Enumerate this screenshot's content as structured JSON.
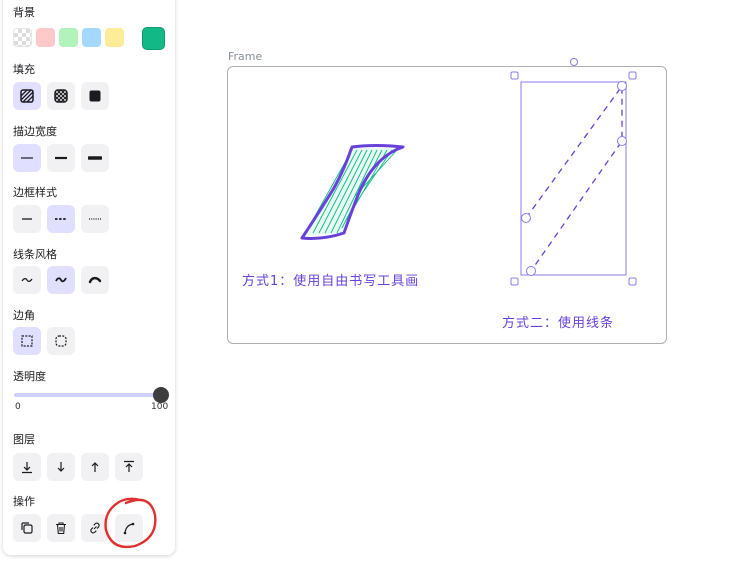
{
  "panel": {
    "background_label": "背景",
    "background_colors": [
      "transparent",
      "#ffc9c9",
      "#b2f2bb",
      "#a5d8ff",
      "#ffec99"
    ],
    "stroke_color": "#12b886",
    "fill_label": "填充",
    "fill_options": [
      "hachure-icon",
      "cross-hatch-icon",
      "solid-icon"
    ],
    "stroke_width_label": "描边宽度",
    "stroke_width_options": [
      "thin",
      "bold",
      "extra-bold"
    ],
    "stroke_style_label": "边框样式",
    "stroke_style_options": [
      "solid",
      "dashed",
      "dotted"
    ],
    "sloppiness_label": "线条风格",
    "sloppiness_options": [
      "architect",
      "artist",
      "cartoonist"
    ],
    "edges_label": "边角",
    "edges_options": [
      "sharp",
      "round"
    ],
    "opacity_label": "透明度",
    "opacity_min": "0",
    "opacity_max": "100",
    "opacity_value": 100,
    "layers_label": "图层",
    "layers_options": [
      "send-to-back-icon",
      "send-backward-icon",
      "bring-forward-icon",
      "bring-to-front-icon"
    ],
    "actions_label": "操作",
    "actions_options": [
      "duplicate-icon",
      "delete-icon",
      "link-icon",
      "curve-edit-icon"
    ]
  },
  "canvas": {
    "frame_label": "Frame",
    "caption_1": "方式1：使用自由书写工具画",
    "caption_2": "方式二：使用线条",
    "accent_color": "#6741d9",
    "selection_color": "#8b7be8",
    "hachure_color": "#12b886",
    "annotation_color": "#e03131"
  }
}
